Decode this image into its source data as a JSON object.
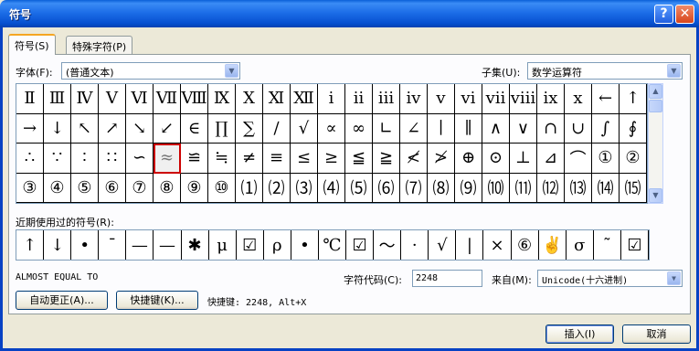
{
  "window": {
    "title": "符号",
    "help_icon": "?",
    "close_icon": "✕"
  },
  "tabs": [
    {
      "label": "符号(S)"
    },
    {
      "label": "特殊字符(P)"
    }
  ],
  "font": {
    "label": "字体(F):",
    "value": "(普通文本)"
  },
  "subset": {
    "label": "子集(U):",
    "value": "数学运算符"
  },
  "symbols": [
    "Ⅱ",
    "Ⅲ",
    "Ⅳ",
    "Ⅴ",
    "Ⅵ",
    "Ⅶ",
    "Ⅷ",
    "Ⅸ",
    "Ⅹ",
    "Ⅺ",
    "Ⅻ",
    "ⅰ",
    "ⅱ",
    "ⅲ",
    "ⅳ",
    "ⅴ",
    "ⅵ",
    "ⅶ",
    "ⅷ",
    "ⅸ",
    "ⅹ",
    "←",
    "↑",
    "→",
    "↓",
    "↖",
    "↗",
    "↘",
    "↙",
    "∈",
    "∏",
    "∑",
    "∕",
    "√",
    "∝",
    "∞",
    "∟",
    "∠",
    "∣",
    "∥",
    "∧",
    "∨",
    "∩",
    "∪",
    "∫",
    "∮",
    "∴",
    "∵",
    "∶",
    "∷",
    "∽",
    "≈",
    "≌",
    "≒",
    "≠",
    "≡",
    "≤",
    "≥",
    "≦",
    "≧",
    "≮",
    "≯",
    "⊕",
    "⊙",
    "⊥",
    "⊿",
    "⌒",
    "①",
    "②",
    "③",
    "④",
    "⑤",
    "⑥",
    "⑦",
    "⑧",
    "⑨",
    "⑩",
    "⑴",
    "⑵",
    "⑶",
    "⑷",
    "⑸",
    "⑹",
    "⑺",
    "⑻",
    "⑼",
    "⑽",
    "⑾",
    "⑿",
    "⒀",
    "⒁",
    "⒂"
  ],
  "selected_index": 51,
  "recent": {
    "label": "近期使用过的符号(R):",
    "symbols": [
      "↑",
      "↓",
      "•",
      "¯",
      "—",
      "—",
      "✱",
      "μ",
      "☑",
      "ρ",
      "•",
      "℃",
      "☑",
      "～",
      "·",
      "√",
      "|",
      "×",
      "⑥",
      "✌",
      "σ",
      "˜",
      "☑"
    ]
  },
  "char_name": "ALMOST EQUAL TO",
  "char_code": {
    "label": "字符代码(C):",
    "value": "2248"
  },
  "from": {
    "label": "来自(M):",
    "value": "Unicode(十六进制)"
  },
  "buttons": {
    "autocorrect": "自动更正(A)...",
    "shortcut_key": "快捷键(K)...",
    "insert": "插入(I)",
    "cancel": "取消"
  },
  "shortcut_text": "快捷键: 2248, Alt+X"
}
